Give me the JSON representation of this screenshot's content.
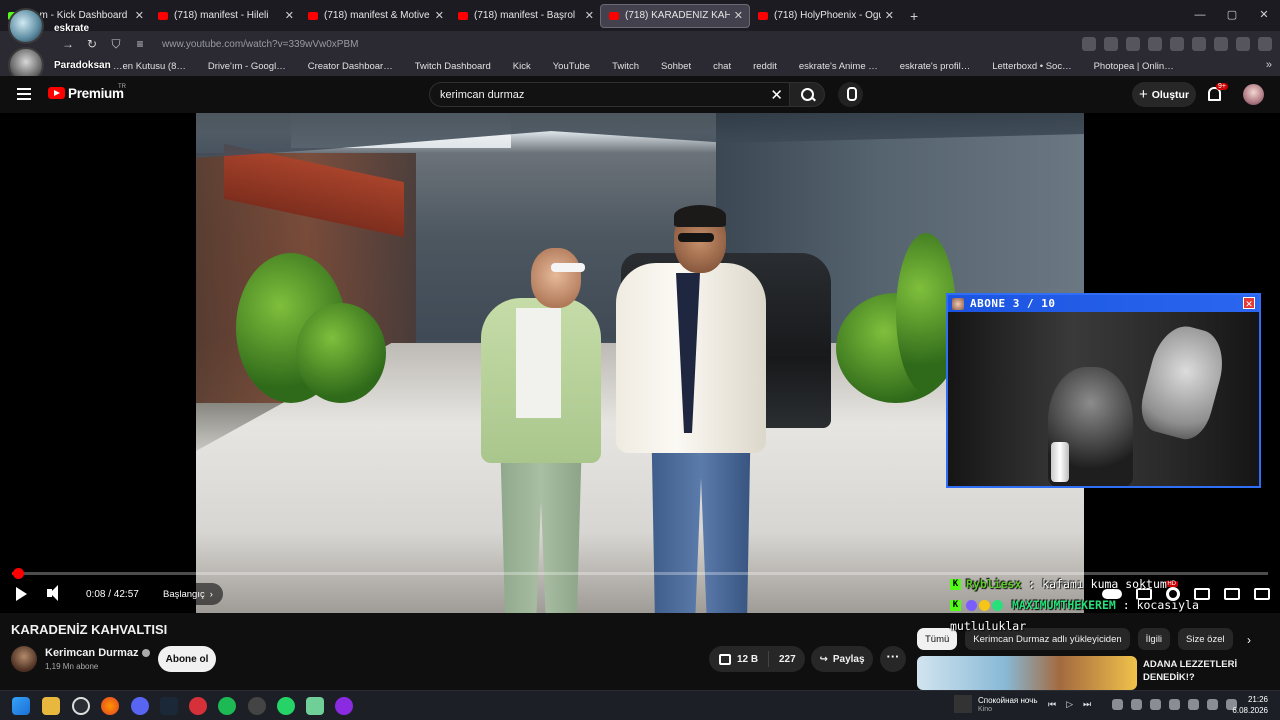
{
  "browser": {
    "tabs": [
      {
        "title": "…am - Kick Dashboard",
        "icon": "kick-icon"
      },
      {
        "title": "(718) manifest - Hileli",
        "icon": "youtube-icon"
      },
      {
        "title": "(718) manifest & Motive",
        "icon": "youtube-icon"
      },
      {
        "title": "(718) manifest - Başrol",
        "icon": "youtube-icon"
      },
      {
        "title": "(718) KARADENİZ KAHVALT",
        "icon": "youtube-icon",
        "active": true
      },
      {
        "title": "(718) HolyPhoenix - Ogu",
        "icon": "youtube-icon"
      }
    ],
    "url": "www.youtube.com/watch?v=339wVw0xPBM",
    "bookmarks": [
      {
        "label": "…en Kutusu (8…",
        "color": "#888888"
      },
      {
        "label": "Drive'ım - Googl…",
        "color": "#f4b400"
      },
      {
        "label": "Creator Dashboar…",
        "color": "#53fc18"
      },
      {
        "label": "Twitch Dashboard",
        "color": "#9146ff"
      },
      {
        "label": "Kick",
        "color": "#53fc18"
      },
      {
        "label": "YouTube",
        "color": "#ff0000"
      },
      {
        "label": "Twitch",
        "color": "#9146ff"
      },
      {
        "label": "Sohbet",
        "color": "#9146ff"
      },
      {
        "label": "chat",
        "color": "#53fc18"
      },
      {
        "label": "reddit",
        "color": "#ff4500"
      },
      {
        "label": "eskrate's Anime …",
        "color": "#2e51a2"
      },
      {
        "label": "eskrate's profil…",
        "color": "#ffffff"
      },
      {
        "label": "Letterboxd • Soc…",
        "color": "#40bcf4"
      },
      {
        "label": "Photopea | Onlin…",
        "color": "#18a497"
      }
    ],
    "profiles": [
      {
        "name": "eskrate"
      },
      {
        "name": "Paradoksan"
      }
    ]
  },
  "youtube": {
    "brand": "Premium",
    "region": "TR",
    "search_query": "kerimcan durmaz",
    "create_label": "Oluştur",
    "notifications": "9+"
  },
  "video": {
    "progress": 0.003,
    "time": "0:08 / 42:57",
    "chapter": "Başlangıç",
    "title": "KARADENİZ KAHVALTISI",
    "channel": "Kerimcan Durmaz",
    "subscribers": "1,19 Mn abone",
    "subscribe_label": "Abone ol",
    "likes": "12 B",
    "comments": "227",
    "share_label": "Paylaş"
  },
  "overlay": {
    "cam_title": "ABONE 3 / 10",
    "chat": [
      {
        "user": "Rybliesx",
        "message": ": kafamı kuma soktum"
      },
      {
        "user": "MAXIMUMTHEKEREM",
        "message": ": kocasıyla mutluluklar"
      }
    ]
  },
  "sidebar": {
    "chips": [
      "Tümü",
      "Kerimcan Durmaz adlı yükleyiciden",
      "İlgili",
      "Size özel"
    ],
    "recommendation_title": "ADANA LEZZETLERİ DENEDİK!?"
  },
  "taskbar": {
    "media_title": "Спокойная ночь",
    "media_artist": "Kino",
    "time": "21:26",
    "date": "6.08.2026"
  }
}
